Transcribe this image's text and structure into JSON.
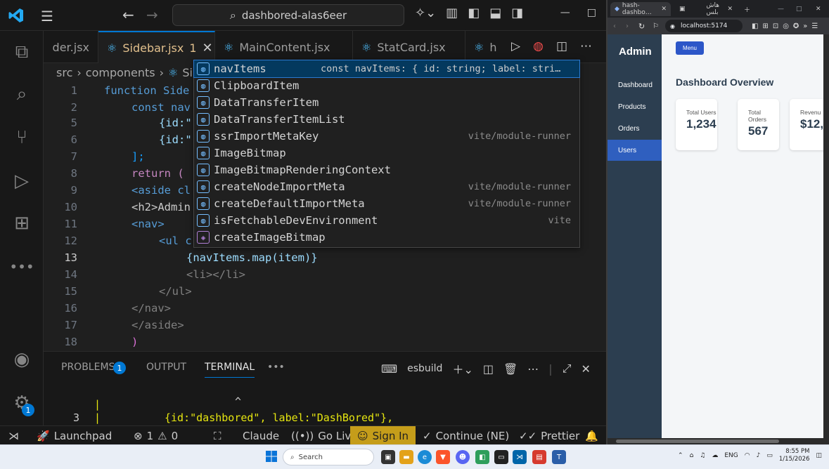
{
  "vscode": {
    "search_text": "dashbored-alas6eer",
    "tabs": [
      {
        "label": "der.jsx"
      },
      {
        "label": "Sidebar.jsx",
        "badge": "1"
      },
      {
        "label": "MainContent.jsx"
      },
      {
        "label": "StatCard.jsx"
      },
      {
        "label": "h"
      }
    ],
    "breadcrumb": [
      "src",
      "components",
      "Si"
    ],
    "activity_badge": "1",
    "code_lines": [
      {
        "num": "1",
        "text": "function Side"
      },
      {
        "num": "2",
        "text": "const nav"
      },
      {
        "num": "5",
        "text": "{id:\""
      },
      {
        "num": "6",
        "text": "{id:\""
      },
      {
        "num": "7",
        "text": "];"
      },
      {
        "num": "8",
        "text": "return ("
      },
      {
        "num": "9",
        "text": "<aside cl"
      },
      {
        "num": "10",
        "text": "<h2>Admin"
      },
      {
        "num": "11",
        "text": "<nav>"
      },
      {
        "num": "12",
        "text": "<ul c"
      },
      {
        "num": "13",
        "text": "{navItems.map(item)}"
      },
      {
        "num": "14",
        "text": "<li></li>"
      },
      {
        "num": "15",
        "text": "</ul>"
      },
      {
        "num": "16",
        "text": "</nav>"
      },
      {
        "num": "17",
        "text": "</aside>"
      },
      {
        "num": "18",
        "text": ")"
      }
    ],
    "suggestions": [
      {
        "label": "navItems",
        "detail": "const navItems: { id: string; label: stri…",
        "kind": "variable"
      },
      {
        "label": "ClipboardItem",
        "detail": "",
        "kind": "variable"
      },
      {
        "label": "DataTransferItem",
        "detail": "",
        "kind": "variable"
      },
      {
        "label": "DataTransferItemList",
        "detail": "",
        "kind": "variable"
      },
      {
        "label": "ssrImportMetaKey",
        "detail": "vite/module-runner",
        "kind": "variable"
      },
      {
        "label": "ImageBitmap",
        "detail": "",
        "kind": "variable"
      },
      {
        "label": "ImageBitmapRenderingContext",
        "detail": "",
        "kind": "variable"
      },
      {
        "label": "createNodeImportMeta",
        "detail": "vite/module-runner",
        "kind": "variable"
      },
      {
        "label": "createDefaultImportMeta",
        "detail": "vite/module-runner",
        "kind": "variable"
      },
      {
        "label": "isFetchableDevEnvironment",
        "detail": "vite",
        "kind": "variable"
      },
      {
        "label": "createImageBitmap",
        "detail": "",
        "kind": "function"
      }
    ],
    "panel": {
      "tabs": [
        "PROBLEMS",
        "OUTPUT",
        "TERMINAL"
      ],
      "problems_count": "1",
      "terminal_name": "esbuild",
      "terminal_caret": "^",
      "terminal_line_num": "3",
      "terminal_bar": "|",
      "terminal_code": "{id:\"dashbored\", label:\"DashBored\"},"
    },
    "status": {
      "launchpad": "Launchpad",
      "errors": "1",
      "warnings": "0",
      "claude": "Claude",
      "golive": "Go Live",
      "signin": "Sign In",
      "continue": "Continue (NE)",
      "prettier": "Prettier"
    }
  },
  "browser": {
    "tab1": "hash-dashbo…",
    "tab2": "هاش بلس",
    "url": "localhost:5174",
    "app": {
      "title": "Admin",
      "nav": [
        "Dashboard",
        "Products",
        "Orders",
        "Users"
      ],
      "menu_button": "Menu",
      "heading": "Dashboard Overview",
      "cards": [
        {
          "label": "Total Users",
          "value": "1,234"
        },
        {
          "label": "Total Orders",
          "value": "567"
        },
        {
          "label": "Revenu",
          "value": "$12,"
        }
      ]
    }
  },
  "taskbar": {
    "search": "Search",
    "lang": "ENG",
    "time": "8:55 PM",
    "date": "1/15/2026"
  }
}
